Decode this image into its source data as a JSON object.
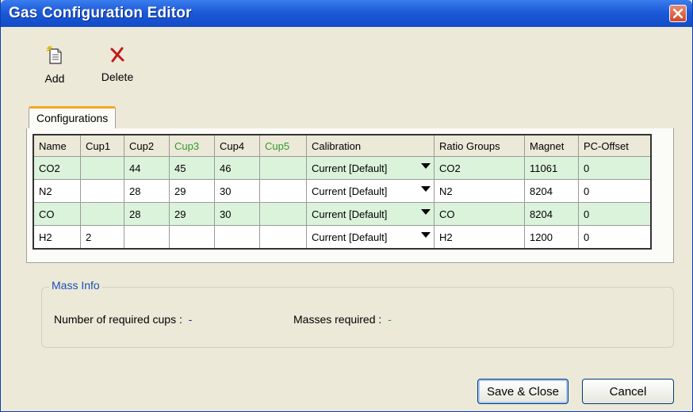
{
  "window": {
    "title": "Gas Configuration Editor"
  },
  "toolbar": {
    "add_label": "Add",
    "delete_label": "Delete"
  },
  "tabs": [
    {
      "label": "Configurations"
    }
  ],
  "table": {
    "headers": [
      "Name",
      "Cup1",
      "Cup2",
      "Cup3",
      "Cup4",
      "Cup5",
      "Calibration",
      "Ratio Groups",
      "Magnet",
      "PC-Offset"
    ],
    "rows": [
      [
        "CO2",
        "",
        "44",
        "45",
        "46",
        "",
        "Current [Default]",
        "CO2",
        "11061",
        "0"
      ],
      [
        "N2",
        "",
        "28",
        "29",
        "30",
        "",
        "Current [Default]",
        "N2",
        "8204",
        "0"
      ],
      [
        "CO",
        "",
        "28",
        "29",
        "30",
        "",
        "Current [Default]",
        "CO",
        "8204",
        "0"
      ],
      [
        "H2",
        "2",
        "",
        "",
        "",
        "",
        "Current [Default]",
        "H2",
        "1200",
        "0"
      ]
    ]
  },
  "mass_info": {
    "legend": "Mass Info",
    "required_cups_label": "Number of required cups :",
    "required_cups_value": "-",
    "masses_label": "Masses required :",
    "masses_value": "-"
  },
  "buttons": {
    "save": "Save & Close",
    "cancel": "Cancel"
  },
  "colors": {
    "title_bar": "#1c5ad8",
    "row_highlight": "#dbf3db",
    "green_header": "#2f9a2f",
    "tab_accent": "#f5a623"
  },
  "icons": {
    "add": "add-document-icon",
    "delete": "red-x-icon",
    "close": "close-icon"
  }
}
